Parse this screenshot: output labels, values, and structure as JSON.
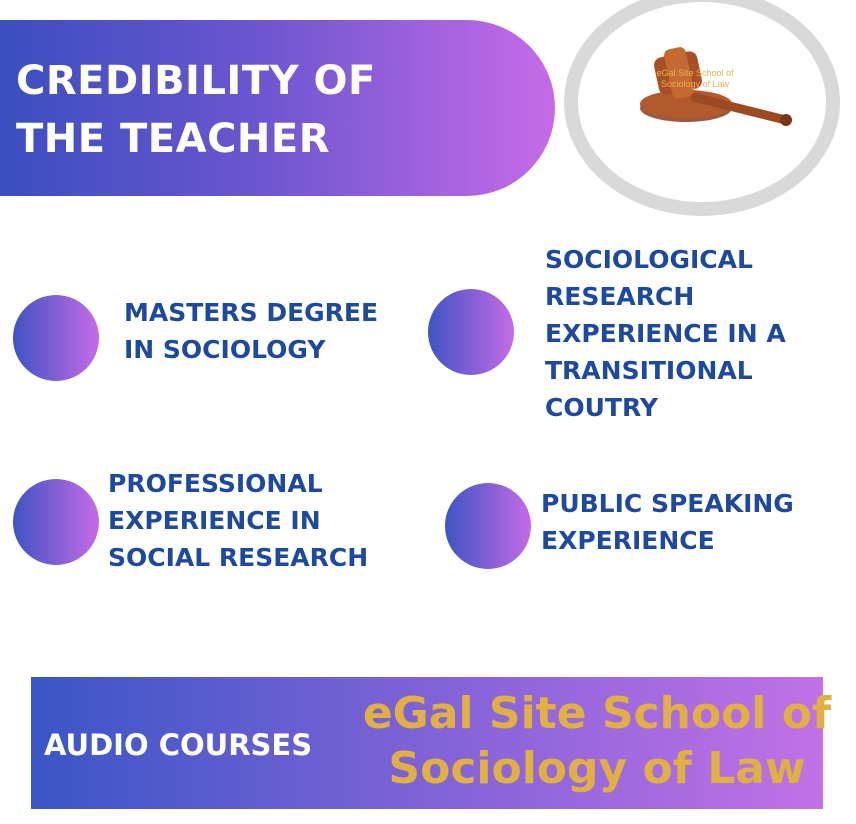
{
  "header": {
    "title_line1": "CREDIBILITY OF",
    "title_line2": "THE TEACHER"
  },
  "logo": {
    "icon": "gavel-icon",
    "caption": "eGal Site School of Sociology of Law"
  },
  "items": [
    {
      "text": "MASTERS DEGREE IN SOCIOLOGY"
    },
    {
      "text": "SOCIOLOGICAL RESEARCH EXPERIENCE IN A TRANSITIONAL COUTRY"
    },
    {
      "text": "PROFESSIONAL EXPERIENCE IN SOCIAL RESEARCH"
    },
    {
      "text": "PUBLIC SPEAKING EXPERIENCE"
    }
  ],
  "footer": {
    "left_label": "AUDIO COURSES",
    "right_label": "eGal Site School of Sociology of Law"
  },
  "colors": {
    "gradient_start": "#3a4fbf",
    "gradient_end": "#c66be8",
    "item_text": "#1d4aa0",
    "footer_accent": "#e0b043",
    "ring": "#d9d9d9"
  }
}
